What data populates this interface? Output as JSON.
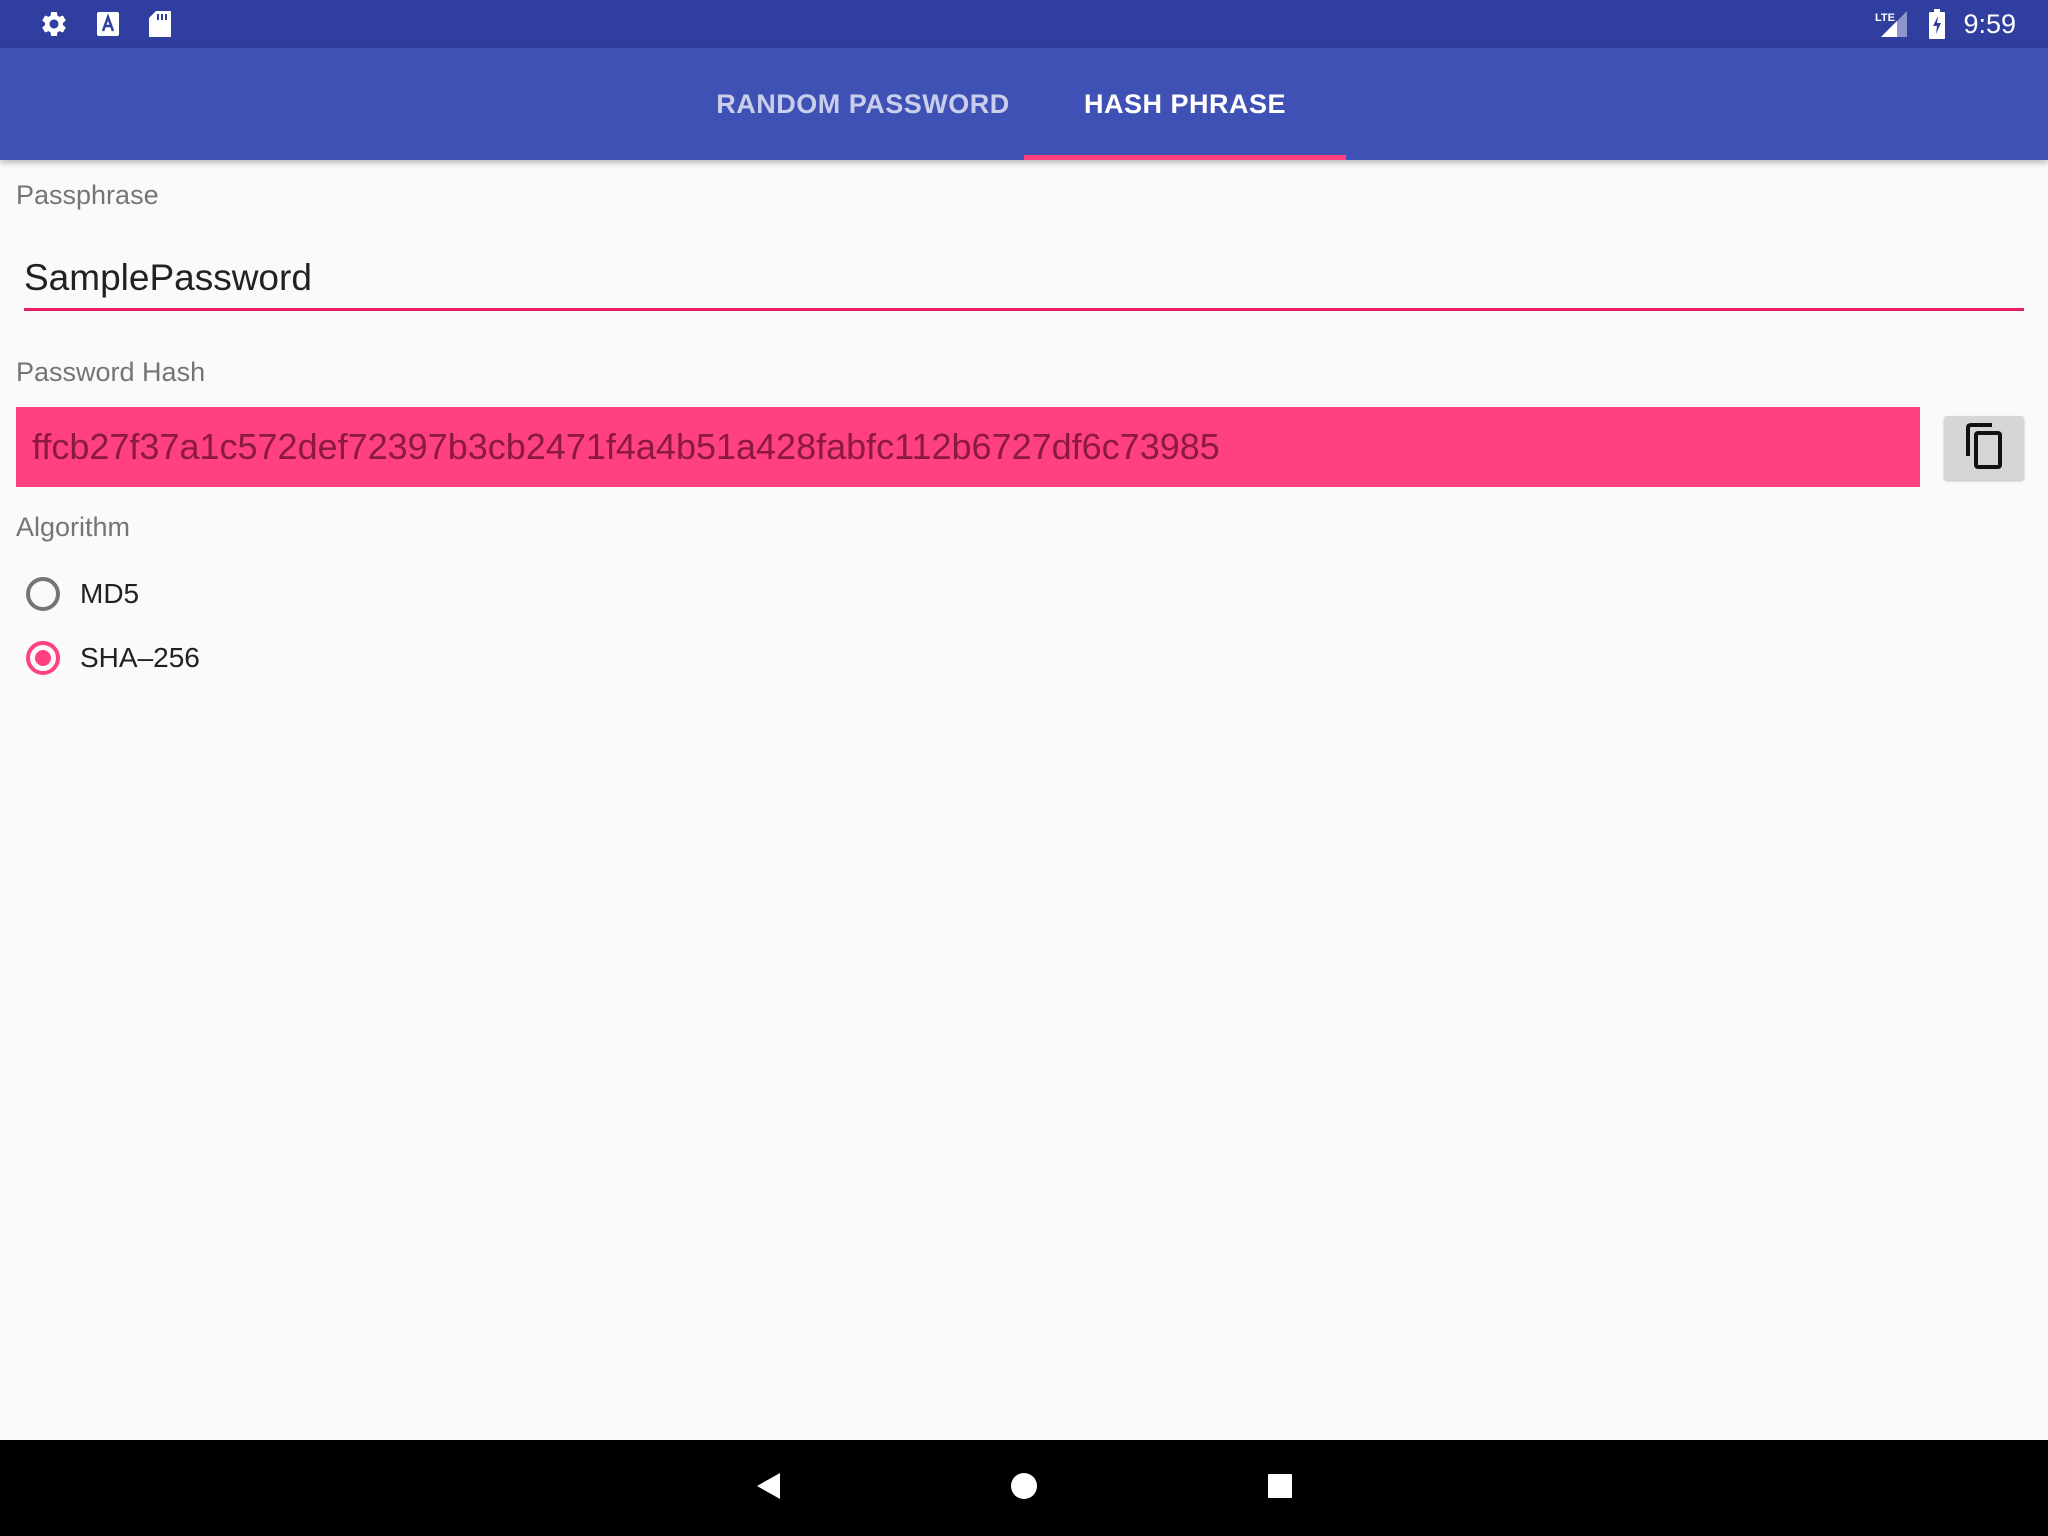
{
  "status_bar": {
    "time": "9:59",
    "left_icons": [
      "gear-icon",
      "text-a-icon",
      "sd-card-icon"
    ],
    "network": "LTE"
  },
  "tabs": [
    {
      "label": "RANDOM PASSWORD",
      "active": false
    },
    {
      "label": "HASH PHRASE",
      "active": true
    }
  ],
  "passphrase": {
    "label": "Passphrase",
    "value": "SamplePassword"
  },
  "password_hash": {
    "label": "Password Hash",
    "value": "ffcb27f37a1c572def72397b3cb2471f4a4b51a428fabfc112b6727df6c73985",
    "copy_icon": "copy-icon"
  },
  "algorithm": {
    "label": "Algorithm",
    "options": [
      {
        "label": "MD5",
        "checked": false
      },
      {
        "label": "SHA–256",
        "checked": true
      }
    ]
  },
  "nav_bar": {
    "icons": [
      "back-icon",
      "home-icon",
      "recents-icon"
    ]
  },
  "colors": {
    "status_bar": "#303f9f",
    "app_bar": "#3f51b5",
    "accent": "#ff4081",
    "background": "#fafafa"
  }
}
